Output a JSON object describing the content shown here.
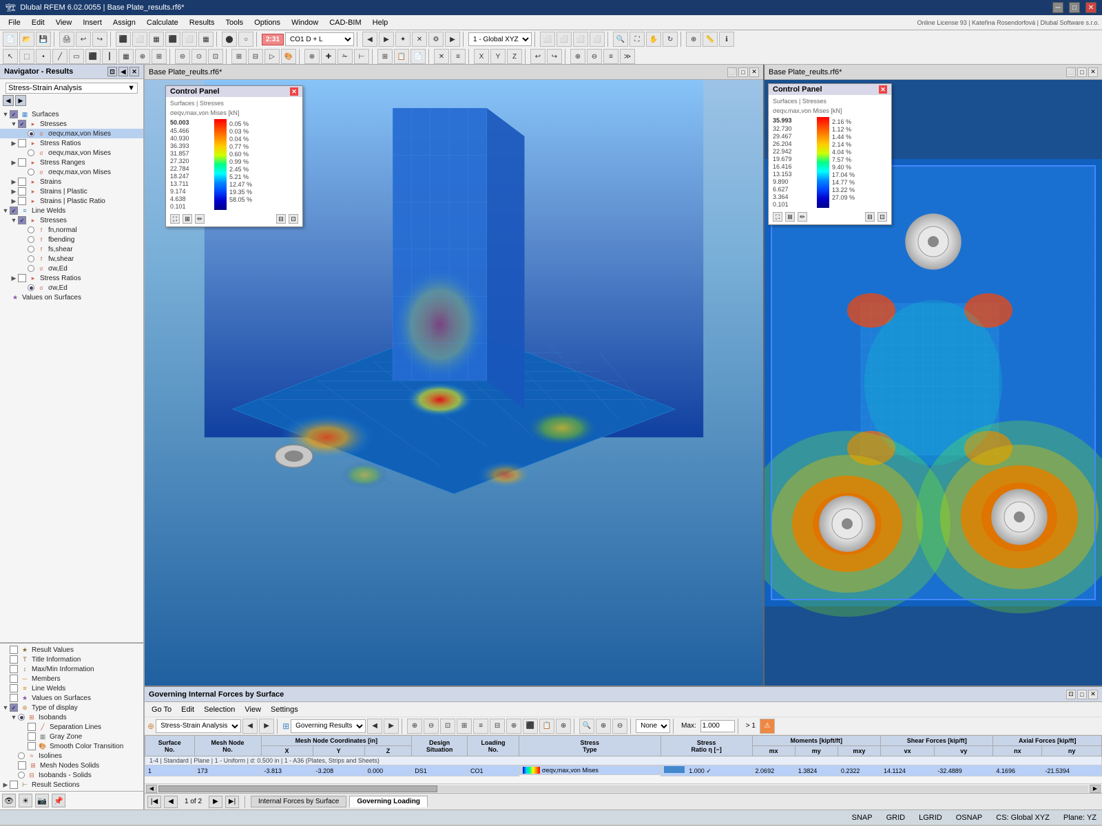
{
  "titlebar": {
    "title": "Dlubal RFEM 6.02.0055 | Base Plate_results.rf6*"
  },
  "menubar": {
    "items": [
      "File",
      "Edit",
      "View",
      "Insert",
      "Assign",
      "Calculate",
      "Results",
      "Tools",
      "Options",
      "Window",
      "CAD-BIM",
      "Help"
    ]
  },
  "toolbar": {
    "badge_text": "2:31",
    "combo_co": "CO1  D + L",
    "combo_cs": "1 - Global XYZ"
  },
  "navigator": {
    "title": "Navigator - Results",
    "dropdown": "Stress-Strain Analysis",
    "tree": [
      {
        "label": "Surfaces",
        "level": 0,
        "type": "group",
        "expanded": true
      },
      {
        "label": "Stresses",
        "level": 1,
        "type": "group",
        "checked": true,
        "expanded": true
      },
      {
        "label": "σeqv,max,von Mises",
        "level": 2,
        "type": "radio",
        "checked": true
      },
      {
        "label": "Stress Ratios",
        "level": 1,
        "type": "group",
        "checked": false,
        "expanded": false
      },
      {
        "label": "σeqv,max,von Mises",
        "level": 2,
        "type": "radio",
        "checked": false
      },
      {
        "label": "Stress Ranges",
        "level": 1,
        "type": "group",
        "checked": false,
        "expanded": false
      },
      {
        "label": "σeqv,max,von Mises",
        "level": 2,
        "type": "radio",
        "checked": false
      },
      {
        "label": "Strains",
        "level": 1,
        "type": "group",
        "checked": false,
        "expanded": false
      },
      {
        "label": "Strains | Plastic",
        "level": 1,
        "type": "group",
        "checked": false
      },
      {
        "label": "Strains | Plastic Ratio",
        "level": 1,
        "type": "group",
        "checked": false
      },
      {
        "label": "Line Welds",
        "level": 0,
        "type": "group",
        "expanded": true
      },
      {
        "label": "Stresses",
        "level": 1,
        "type": "group",
        "checked": true,
        "expanded": true
      },
      {
        "label": "fn,normal",
        "level": 2,
        "type": "radio",
        "checked": false
      },
      {
        "label": "fbending",
        "level": 2,
        "type": "radio",
        "checked": false
      },
      {
        "label": "fs,shear",
        "level": 2,
        "type": "radio",
        "checked": false
      },
      {
        "label": "fw,shear",
        "level": 2,
        "type": "radio",
        "checked": false
      },
      {
        "label": "σw,Ed",
        "level": 2,
        "type": "radio",
        "checked": false
      },
      {
        "label": "Stress Ratios",
        "level": 1,
        "type": "group",
        "checked": false
      },
      {
        "label": "σw,Ed",
        "level": 2,
        "type": "radio",
        "checked": true
      },
      {
        "label": "Values on Surfaces",
        "level": 0,
        "type": "item"
      }
    ],
    "lower_tree": [
      {
        "label": "Result Values",
        "level": 0,
        "checked": false
      },
      {
        "label": "Title Information",
        "level": 0,
        "checked": false
      },
      {
        "label": "Max/Min Information",
        "level": 0,
        "checked": false
      },
      {
        "label": "Members",
        "level": 0,
        "checked": false
      },
      {
        "label": "Line Welds",
        "level": 0,
        "checked": false
      },
      {
        "label": "Values on Surfaces",
        "level": 0,
        "checked": false
      },
      {
        "label": "Type of display",
        "level": 0,
        "checked": true,
        "expanded": true
      },
      {
        "label": "Isobands",
        "level": 1,
        "radio": true,
        "checked": true
      },
      {
        "label": "Separation Lines",
        "level": 2,
        "checked": false
      },
      {
        "label": "Gray Zone",
        "level": 2,
        "checked": false
      },
      {
        "label": "Smooth Color Transition",
        "level": 2,
        "checked": false
      },
      {
        "label": "Isolines",
        "level": 1,
        "radio": true,
        "checked": false
      },
      {
        "label": "Mesh Nodes Solids",
        "level": 1,
        "checked": false
      },
      {
        "label": "Isobands - Solids",
        "level": 1,
        "radio": true,
        "checked": false
      },
      {
        "label": "Result Sections",
        "level": 0,
        "checked": false
      }
    ]
  },
  "control_panel_left": {
    "title": "Control Panel",
    "subtitle1": "Surfaces | Stresses",
    "subtitle2": "σeqv,max,von Mises [kN]",
    "values": [
      {
        "val": "50.003",
        "pct": "0.05 %"
      },
      {
        "val": "45.466",
        "pct": "0.03 %"
      },
      {
        "val": "40.930",
        "pct": "0.04 %"
      },
      {
        "val": "36.393",
        "pct": "0.77 %"
      },
      {
        "val": "31.857",
        "pct": "0.60 %"
      },
      {
        "val": "27.320",
        "pct": "0.99 %"
      },
      {
        "val": "22.784",
        "pct": "2.45 %"
      },
      {
        "val": "18.247",
        "pct": "5.21 %"
      },
      {
        "val": "13.711",
        "pct": "12.47 %"
      },
      {
        "val": "9.174",
        "pct": "19.35 %"
      },
      {
        "val": "4.638",
        "pct": "58.05 %"
      },
      {
        "val": "0.101",
        "pct": ""
      }
    ]
  },
  "control_panel_right": {
    "title": "Control Panel",
    "subtitle1": "Surfaces | Stresses",
    "subtitle2": "σeqv,max,von Mises [kN]",
    "values": [
      {
        "val": "35.993",
        "pct": "2.16 %"
      },
      {
        "val": "32.730",
        "pct": "1.12 %"
      },
      {
        "val": "29.467",
        "pct": "1.44 %"
      },
      {
        "val": "26.204",
        "pct": "2.14 %"
      },
      {
        "val": "22.942",
        "pct": "4.04 %"
      },
      {
        "val": "19.679",
        "pct": "7.57 %"
      },
      {
        "val": "16.416",
        "pct": "9.40 %"
      },
      {
        "val": "13.153",
        "pct": "17.04 %"
      },
      {
        "val": "9.890",
        "pct": "14.77 %"
      },
      {
        "val": "6.627",
        "pct": "13.22 %"
      },
      {
        "val": "3.364",
        "pct": "27.09 %"
      },
      {
        "val": "0.101",
        "pct": ""
      }
    ]
  },
  "viewport_left": {
    "title": "Base Plate_reults.rf6*"
  },
  "viewport_right": {
    "title": "Base Plate_reults.rf6*"
  },
  "governing_panel": {
    "title": "Governing Internal Forces by Surface",
    "menus": [
      "Go To",
      "Edit",
      "Selection",
      "View",
      "Settings"
    ],
    "combo1": "Stress-Strain Analysis",
    "combo2": "Governing Results",
    "combo_none": "None",
    "combo_max": "Max:",
    "max_val": "1.000",
    "columns": [
      "Surface No.",
      "Mesh Node No.",
      "Mesh Node Coordinates [in]",
      "",
      "",
      "Design Situation",
      "Loading No.",
      "Stress Type",
      "Stress Ratio η [−]",
      "Moments [kipft/ft]",
      "",
      "",
      "Shear Forces [kip/ft]",
      "",
      "Axial Forces [kip/ft]",
      ""
    ],
    "sub_columns": [
      "",
      "",
      "X",
      "Y",
      "Z",
      "",
      "",
      "",
      "",
      "mx",
      "my",
      "mxy",
      "vx",
      "vy",
      "nx",
      "ny"
    ],
    "row1": {
      "surface": "1",
      "mesh_node": "1-4 | Standard | Plane | 1 - Uniform | d: 0.500 in | 1 - A36 (Plates, Strips and Sheets)",
      "node_no": "173",
      "x": "-3.813",
      "y": "-3.208",
      "z": "0.000",
      "design_sit": "DS1",
      "loading": "CO1",
      "stress_type": "σeqv,max,von Mises",
      "ratio": "1.000",
      "mx": "2.0692",
      "my": "1.3824",
      "mxy": "0.2322",
      "vx": "14.1124",
      "vy": "-32.4889",
      "nx": "4.1696",
      "ny": "-21.5394"
    },
    "tabs": [
      "Internal Forces by Surface",
      "Governing Loading"
    ],
    "active_tab": "Governing Loading",
    "page": "1 of 2"
  },
  "status_bar": {
    "snap": "SNAP",
    "grid": "GRID",
    "lgrid": "LGRID",
    "osnap": "OSNAP",
    "cs": "CS: Global XYZ",
    "plane": "Plane: YZ"
  }
}
